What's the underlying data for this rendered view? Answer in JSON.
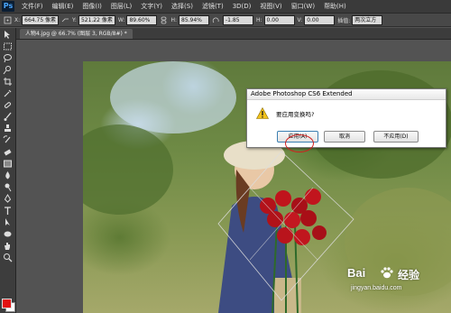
{
  "app": {
    "logo": "Ps",
    "name": "Adobe Photoshop CS6 Extended"
  },
  "menu": [
    "文件(F)",
    "编辑(E)",
    "图像(I)",
    "图层(L)",
    "文字(Y)",
    "选择(S)",
    "滤镜(T)",
    "3D(D)",
    "视图(V)",
    "窗口(W)",
    "帮助(H)"
  ],
  "options": {
    "x_label": "X:",
    "x_value": "664.75 像素",
    "y_label": "Y:",
    "y_value": "521.22 像素",
    "w_label": "W:",
    "w_value": "89.60%",
    "h_label": "H:",
    "h_value": "85.94%",
    "angle_value": "-1.85",
    "hskew_label": "H:",
    "hskew_value": "0.00",
    "vskew_label": "V:",
    "vskew_value": "0.00",
    "interp_label": "插值:",
    "interp_value": "两次立方"
  },
  "document": {
    "tab": "人物4.jpg @ 66.7% (图层 3, RGB/8#) *"
  },
  "dialog": {
    "title": "Adobe Photoshop CS6 Extended",
    "message": "要应用变换吗?",
    "apply": "应用(A)",
    "cancel": "取消",
    "no_apply": "不应用(D)"
  },
  "watermark": {
    "brand": "Bai",
    "cn": "经验",
    "url": "jingyan.baidu.com"
  },
  "colors": {
    "foreground": "#e21010",
    "background": "#ffffff",
    "accent": "#d21e1e"
  }
}
